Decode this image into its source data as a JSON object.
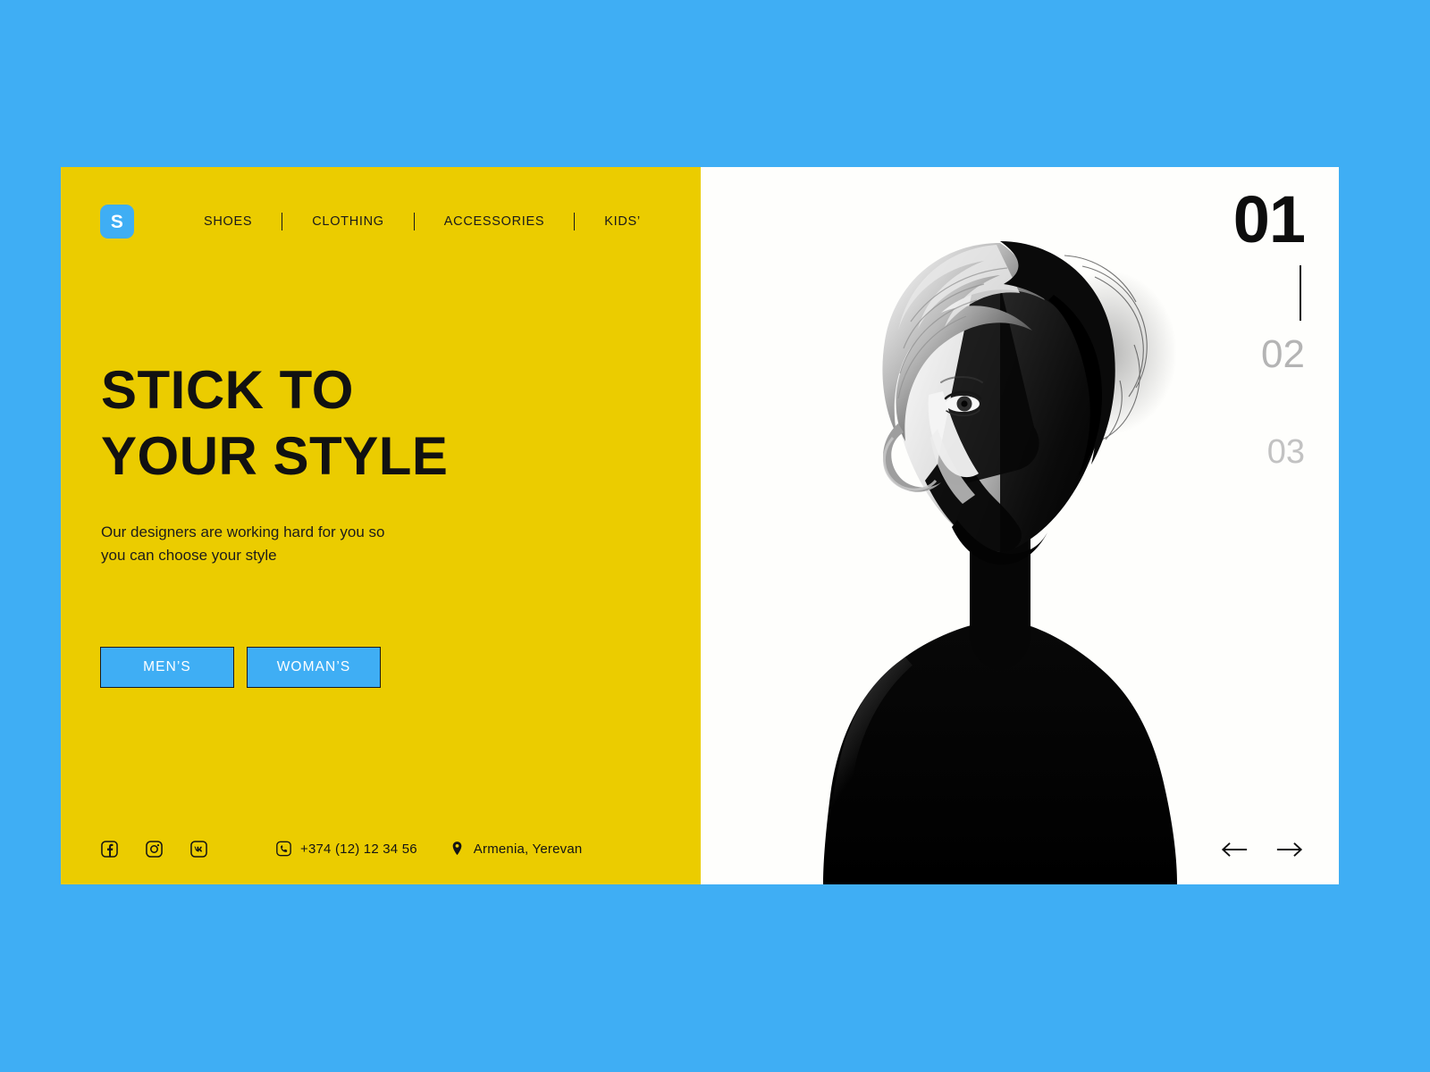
{
  "theme": {
    "background_blue": "#3FAEF4",
    "panel_yellow": "#EBCC00",
    "panel_white": "#FEFEFC",
    "accent_blue": "#3FAEF4",
    "text_black": "#111111",
    "muted_gray": "#B4B4B4"
  },
  "brand": {
    "logo_mark": "S"
  },
  "nav": {
    "items": [
      {
        "label": "SHOES"
      },
      {
        "label": "CLOTHING"
      },
      {
        "label": "ACCESSORIES"
      },
      {
        "label": "KIDS’"
      }
    ],
    "separator": "|"
  },
  "hero": {
    "headline_line1": "STICK TO",
    "headline_line2": "YOUR STYLE",
    "subcopy_line1": "Our designers are working hard for you so",
    "subcopy_line2": "you can choose your style",
    "cta": [
      {
        "label": "MEN’S"
      },
      {
        "label": "WOMAN’S"
      }
    ]
  },
  "footer": {
    "socials": [
      {
        "name": "facebook-icon"
      },
      {
        "name": "instagram-icon"
      },
      {
        "name": "vk-icon"
      }
    ],
    "phone": "+374 (12) 12 34 56",
    "location": "Armenia, Yerevan"
  },
  "slider": {
    "current": "01",
    "next": "02",
    "after_next": "03",
    "prev_arrow": "←",
    "next_arrow": "→"
  },
  "media": {
    "alt": "High-contrast black and white portrait of a woman, half her face in deep shadow"
  }
}
